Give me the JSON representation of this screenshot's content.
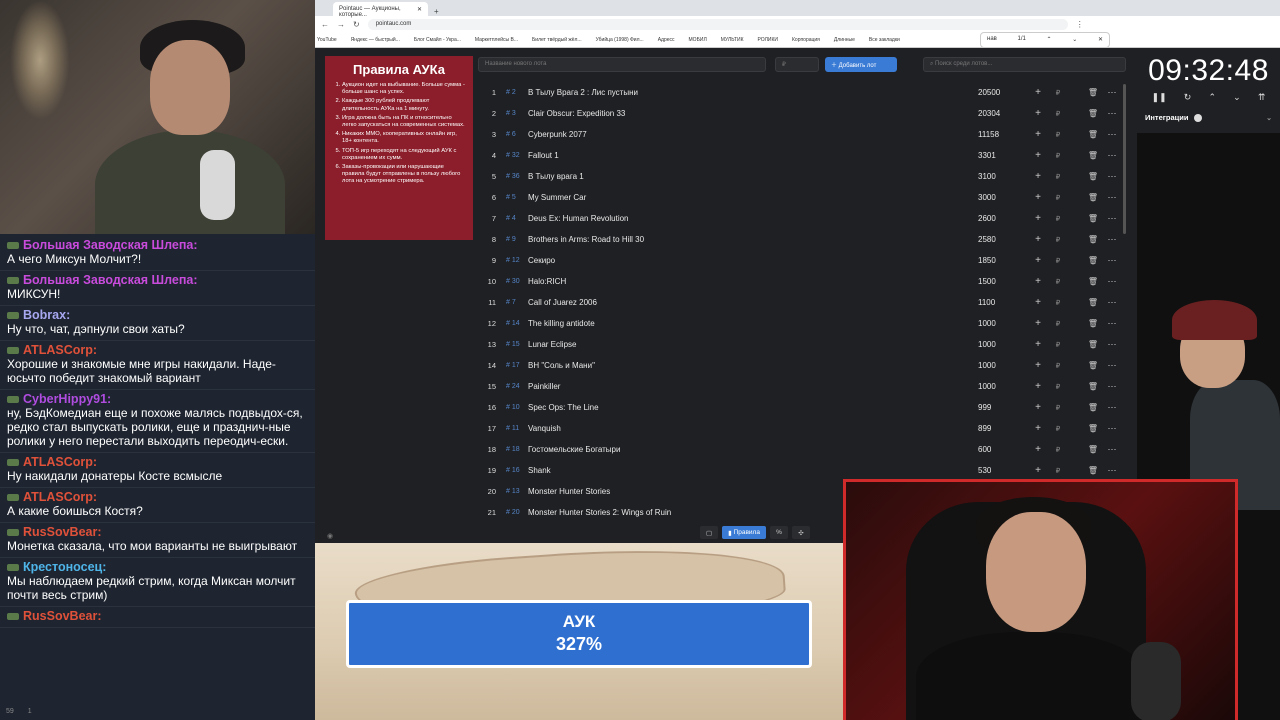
{
  "browser": {
    "tab_title": "Pointauc — Аукционы, которые...",
    "url": "pointauc.com",
    "bookmarks": [
      "YouTube",
      "Яндекс — быстрый...",
      "Блог Смайл - Укра...",
      "Маркетплейсы В...",
      "Билет твёрдый жёл...",
      "Убийца (1998) Фил...",
      "Адресс",
      "МОБИЛ",
      "МУЛЬТИК",
      "РОЛИКИ",
      "Корпорация",
      "Длинные",
      "Все закладки"
    ],
    "find_query": "нав",
    "find_count": "1/1"
  },
  "rules": {
    "title": "Правила АУКа",
    "items": [
      "Аукцион идет на выбывание. Больше сумма - больше шанс на успех.",
      "Каждые 300 рублей продлевают длительность АУКа на 1 минуту.",
      "Игра должна быть на ПК и относительно легко запускаться на современных системах.",
      "Никаких MMO, кооперативных онлайн игр, 18+ контента.",
      "ТОП-5 игр переходят на следующий АУК с сохранением их сумм.",
      "Заказы-провокации или нарушающие правила будут отправлены в пользу любого лота на усмотрение стримера."
    ]
  },
  "controls": {
    "lot_placeholder": "Название нового лота",
    "price_placeholder": "₽",
    "add_label": "Добавить лот",
    "search_placeholder": "Поиск среди лотов..."
  },
  "lots": [
    {
      "num": "1",
      "id": "# 2",
      "name": "В Тылу Врага 2 : Лис пустыни",
      "amount": "20500"
    },
    {
      "num": "2",
      "id": "# 3",
      "name": "Clair Obscur: Expedition 33",
      "amount": "20304"
    },
    {
      "num": "3",
      "id": "# 6",
      "name": "Cyberpunk 2077",
      "amount": "11158"
    },
    {
      "num": "4",
      "id": "# 32",
      "name": "Fallout 1",
      "amount": "3301"
    },
    {
      "num": "5",
      "id": "# 36",
      "name": "В Тылу врага 1",
      "amount": "3100"
    },
    {
      "num": "6",
      "id": "# 5",
      "name": "My Summer Car",
      "amount": "3000"
    },
    {
      "num": "7",
      "id": "# 4",
      "name": "Deus Ex: Human Revolution",
      "amount": "2600"
    },
    {
      "num": "8",
      "id": "# 9",
      "name": "Brothers in Arms: Road to Hill 30",
      "amount": "2580"
    },
    {
      "num": "9",
      "id": "# 12",
      "name": "Секиро",
      "amount": "1850"
    },
    {
      "num": "10",
      "id": "# 30",
      "name": "Halo:RICH",
      "amount": "1500"
    },
    {
      "num": "11",
      "id": "# 7",
      "name": "Call of Juarez 2006",
      "amount": "1100"
    },
    {
      "num": "12",
      "id": "# 14",
      "name": "The killing antidote",
      "amount": "1000"
    },
    {
      "num": "13",
      "id": "# 15",
      "name": "Lunar Eclipse",
      "amount": "1000"
    },
    {
      "num": "14",
      "id": "# 17",
      "name": "ВН \"Соль и Мани\"",
      "amount": "1000"
    },
    {
      "num": "15",
      "id": "# 24",
      "name": "Painkiller",
      "amount": "1000"
    },
    {
      "num": "16",
      "id": "# 10",
      "name": "Spec Ops: The Line",
      "amount": "999"
    },
    {
      "num": "17",
      "id": "# 11",
      "name": "Vanquish",
      "amount": "899"
    },
    {
      "num": "18",
      "id": "# 18",
      "name": "Гостомельские Богатыри",
      "amount": "600"
    },
    {
      "num": "19",
      "id": "# 16",
      "name": "Shank",
      "amount": "530"
    },
    {
      "num": "20",
      "id": "# 13",
      "name": "Monster Hunter Stories",
      "amount": ""
    },
    {
      "num": "21",
      "id": "# 20",
      "name": "Monster Hunter Stories 2: Wings of Ruin",
      "amount": ""
    }
  ],
  "toolbar": {
    "rules_label": "Правила",
    "percent_label": "%"
  },
  "timer": {
    "value": "09:32:48",
    "integration_label": "Интеграции"
  },
  "overlay": {
    "line1": "АУК",
    "line2": "327%"
  },
  "chat": [
    {
      "nick": "Большая Заводская Шлепа:",
      "color": "#c84bdc",
      "text": "А чего Миксун Молчит?!"
    },
    {
      "nick": "Большая Заводская Шлепа:",
      "color": "#c84bdc",
      "text": "МИКСУН!"
    },
    {
      "nick": "Bobrax:",
      "color": "#a7a7f0",
      "text": "Ну что, чат, дэпнули свои хаты?"
    },
    {
      "nick": "ATLASCorp:",
      "color": "#e0513a",
      "text": "Хорошие и знакомые мне игры накидали. Наде-юсьчто победит знакомый вариант"
    },
    {
      "nick": "CyberHippy91:",
      "color": "#b04ce0",
      "text": "ну, БэдКомедиан еще и похоже малясь подвыдох-ся, редко стал выпускать ролики, еще и празднич-ные ролики у него перестали выходить переодич-ески."
    },
    {
      "nick": "ATLASCorp:",
      "color": "#e0513a",
      "text": "Ну накидали донатеры Косте всмысле"
    },
    {
      "nick": "ATLASCorp:",
      "color": "#e0513a",
      "text": "А какие боишься Костя?"
    },
    {
      "nick": "RusSovBear:",
      "color": "#e0513a",
      "text": "Монетка сказала, что мои варианты не выигрывают"
    },
    {
      "nick": "Крестоносец:",
      "color": "#4fb4e8",
      "text": "Мы наблюдаем редкий стрим, когда Миксан молчит почти весь стрим)"
    },
    {
      "nick": "RusSovBear:",
      "color": "#e0513a",
      "text": ""
    }
  ],
  "chat_footer": {
    "viewers": "59",
    "extra": "1"
  }
}
